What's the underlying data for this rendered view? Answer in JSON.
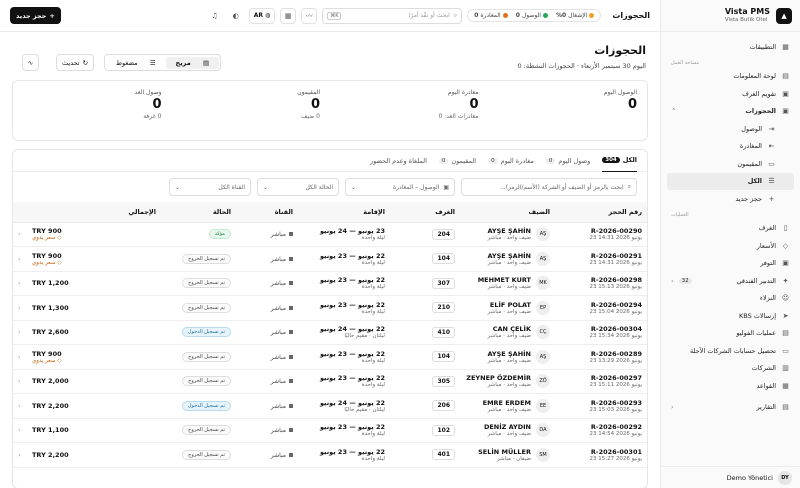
{
  "brand": {
    "name": "Vista PMS",
    "subtitle": "Vista Butik Otel"
  },
  "top": {
    "page_title": "الحجوزات",
    "occupancy_label": "الإشغال",
    "occupancy_value": "0%",
    "arrivals_label": "الوصول",
    "arrivals_value": "0",
    "departures_label": "المغادرة",
    "departures_value": "0",
    "search_placeholder": "ابحث أو نفّذ أمرًا",
    "search_kbd": "⌘K",
    "lang": "AR",
    "new_booking": "حجز جديد"
  },
  "sidebar": {
    "items": [
      {
        "label": "التطبيقات"
      },
      {
        "label": "مساحة العمل"
      },
      {
        "label": "لوحة المعلومات"
      },
      {
        "label": "تقويم الغرف"
      },
      {
        "label": "الحجوزات"
      },
      {
        "label": "الوصول"
      },
      {
        "label": "المغادرة"
      },
      {
        "label": "المقيمون"
      },
      {
        "label": "الكل"
      },
      {
        "label": "حجز جديد"
      },
      {
        "label": "العمليات"
      },
      {
        "label": "الغرف"
      },
      {
        "label": "الأسعار"
      },
      {
        "label": "التوفر"
      },
      {
        "label": "التدبير الفندقي",
        "count": "32"
      },
      {
        "label": "النزلاء"
      },
      {
        "label": "إرسالات KBS"
      },
      {
        "label": "عمليات الفوليو"
      },
      {
        "label": "تحصيل حسابات الشركات الآجلة"
      },
      {
        "label": "الشركات"
      },
      {
        "label": "القواعد"
      },
      {
        "label": "التقارير"
      }
    ],
    "user_name": "Demo Yönetici",
    "user_initials": "DY"
  },
  "header": {
    "title": "الحجوزات",
    "subtitle": "اليوم 30 سبتمبر الأربعاء · الحجوزات النشطة: 0",
    "refresh": "تحديث",
    "view_wide": "مريح",
    "view_compact": "مضغوط"
  },
  "cards": [
    {
      "label": "الوصول اليوم",
      "value": "0",
      "sub": ""
    },
    {
      "label": "مغادرة اليوم",
      "value": "0",
      "sub": "مغادرات الغد: 0"
    },
    {
      "label": "المقيمون",
      "value": "0",
      "sub": "0 ضيف"
    },
    {
      "label": "وصول الغد",
      "value": "0",
      "sub": "0 غرفة"
    }
  ],
  "tabs": [
    {
      "label": "الكل",
      "count": "304"
    },
    {
      "label": "وصول اليوم",
      "count": "0"
    },
    {
      "label": "مغادرة اليوم",
      "count": "0"
    },
    {
      "label": "المقيمون",
      "count": "0"
    },
    {
      "label": "الملغاة وعدم الحضور",
      "count": ""
    }
  ],
  "filters": {
    "search_placeholder": "ابحث بالرمز أو الضيف أو الشركة (الأسم/الرمز)...",
    "date": "الوصول – المغادرة",
    "status": "الحالة  الكل",
    "channel": "القناة  الكل"
  },
  "table": {
    "headers": [
      "رقم الحجز",
      "الضيف",
      "الغرف",
      "الإقامة",
      "القناة",
      "الحالة",
      "الإجمالي"
    ],
    "rows": [
      {
        "code": "R-2026-00290",
        "date": "23 يونيو 2026 14:31",
        "guest": "AYŞE ŞAHİN",
        "gsub": "ضيف واحد · مباشر",
        "init": "AŞ",
        "room": "204",
        "stay": "23 يونيو — 24 يونيو",
        "nights": "ليلة واحدة",
        "channel": "مباشر",
        "status": "مؤكد",
        "stype": "ok",
        "total": "TRY 900",
        "unpaid": "سعر يدوي"
      },
      {
        "code": "R-2026-00291",
        "date": "23 يونيو 2026 14:31",
        "guest": "AYŞE ŞAHİN",
        "gsub": "ضيف واحد · مباشر",
        "init": "AŞ",
        "room": "104",
        "stay": "22 يونيو — 23 يونيو",
        "nights": "ليلة واحدة",
        "channel": "مباشر",
        "status": "تم تسجيل الخروج",
        "stype": "out",
        "total": "TRY 900",
        "unpaid": "سعر يدوي"
      },
      {
        "code": "R-2026-00298",
        "date": "23 يونيو 2026 15:13",
        "guest": "MEHMET KURT",
        "gsub": "ضيف واحد · مباشر",
        "init": "MK",
        "room": "307",
        "stay": "22 يونيو — 23 يونيو",
        "nights": "ليلة واحدة",
        "channel": "مباشر",
        "status": "تم تسجيل الخروج",
        "stype": "out",
        "total": "TRY 1,200",
        "unpaid": ""
      },
      {
        "code": "R-2026-00294",
        "date": "23 يونيو 2026 15:04",
        "guest": "ELİF POLAT",
        "gsub": "ضيف واحد · مباشر",
        "init": "EP",
        "room": "210",
        "stay": "22 يونيو — 23 يونيو",
        "nights": "ليلة واحدة",
        "channel": "مباشر",
        "status": "تم تسجيل الخروج",
        "stype": "out",
        "total": "TRY 1,300",
        "unpaid": ""
      },
      {
        "code": "R-2026-00304",
        "date": "23 يونيو 2026 15:34",
        "guest": "CAN ÇELİK",
        "gsub": "ضيف واحد · مباشر",
        "init": "CÇ",
        "room": "410",
        "stay": "22 يونيو — 24 يونيو",
        "nights": "ليلتان · مقيم حاليًا",
        "channel": "مباشر",
        "status": "تم تسجيل الدخول",
        "stype": "in",
        "total": "TRY 2,600",
        "unpaid": ""
      },
      {
        "code": "R-2026-00289",
        "date": "23 يونيو 2026 13:29",
        "guest": "AYŞE ŞAHİN",
        "gsub": "ضيف واحد · مباشر",
        "init": "AŞ",
        "room": "104",
        "stay": "22 يونيو — 23 يونيو",
        "nights": "ليلة واحدة",
        "channel": "مباشر",
        "status": "تم تسجيل الخروج",
        "stype": "out",
        "total": "TRY 900",
        "unpaid": "سعر يدوي"
      },
      {
        "code": "R-2026-00297",
        "date": "23 يونيو 2026 15:11",
        "guest": "ZEYNEP ÖZDEMİR",
        "gsub": "ضيف واحد · مباشر",
        "init": "ZÖ",
        "room": "305",
        "stay": "22 يونيو — 23 يونيو",
        "nights": "ليلة واحدة",
        "channel": "مباشر",
        "status": "تم تسجيل الخروج",
        "stype": "out",
        "total": "TRY 2,000",
        "unpaid": ""
      },
      {
        "code": "R-2026-00293",
        "date": "23 يونيو 2026 15:03",
        "guest": "EMRE ERDEM",
        "gsub": "ضيف واحد · مباشر",
        "init": "EE",
        "room": "206",
        "stay": "22 يونيو — 24 يونيو",
        "nights": "ليلتان · مقيم حاليًا",
        "channel": "مباشر",
        "status": "تم تسجيل الدخول",
        "stype": "in",
        "total": "TRY 2,200",
        "unpaid": ""
      },
      {
        "code": "R-2026-00292",
        "date": "23 يونيو 2026 14:54",
        "guest": "DENİZ AYDIN",
        "gsub": "ضيف واحد · مباشر",
        "init": "DA",
        "room": "102",
        "stay": "22 يونيو — 23 يونيو",
        "nights": "ليلة واحدة",
        "channel": "مباشر",
        "status": "تم تسجيل الخروج",
        "stype": "out",
        "total": "TRY 1,100",
        "unpaid": ""
      },
      {
        "code": "R-2026-00301",
        "date": "23 يونيو 2026 15:27",
        "guest": "SELİN MÜLLER",
        "gsub": "ضيفان · مباشر",
        "init": "SM",
        "room": "401",
        "stay": "22 يونيو — 23 يونيو",
        "nights": "ليلة واحدة",
        "channel": "مباشر",
        "status": "تم تسجيل الخروج",
        "stype": "out",
        "total": "TRY 2,200",
        "unpaid": ""
      }
    ]
  }
}
